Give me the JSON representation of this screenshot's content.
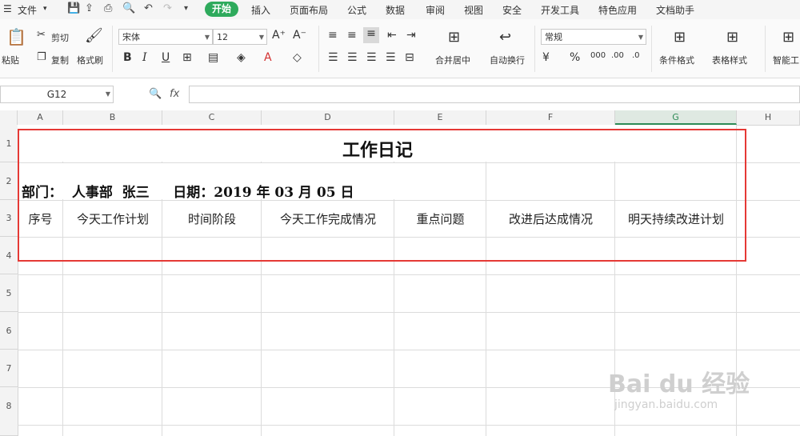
{
  "menu": {
    "file": "文件",
    "tabs": [
      "开始",
      "插入",
      "页面布局",
      "公式",
      "数据",
      "审阅",
      "视图",
      "安全",
      "开发工具",
      "特色应用",
      "文档助手"
    ]
  },
  "ribbon": {
    "paste": "粘贴",
    "cut": "剪切",
    "copy": "复制",
    "format_painter": "格式刷",
    "font_name": "宋体",
    "font_size": "12",
    "merge_center": "合并居中",
    "wrap_text": "自动换行",
    "number_format": "常规",
    "conditional_format": "条件格式",
    "table_style": "表格样式",
    "smart_tools": "智能工"
  },
  "formula_bar": {
    "cell_ref": "G12",
    "fx": "fx",
    "value": ""
  },
  "columns": [
    "A",
    "B",
    "C",
    "D",
    "E",
    "F",
    "G",
    "H"
  ],
  "selected_column": "G",
  "rows": [
    "1",
    "2",
    "3",
    "4",
    "5",
    "6",
    "7",
    "8"
  ],
  "sheet": {
    "title": "工作日记",
    "info_line": "部门：  人事部  张三     日期：2019 年 03 月 05 日",
    "headers": [
      "序号",
      "今天工作计划",
      "时间阶段",
      "今天工作完成情况",
      "重点问题",
      "改进后达成情况",
      "明天持续改进计划"
    ]
  },
  "watermark": {
    "brand": "Bai du 经验",
    "url": "jingyan.baidu.com"
  },
  "colors": {
    "accent": "#2eaa5c",
    "highlight_border": "#e53935"
  }
}
